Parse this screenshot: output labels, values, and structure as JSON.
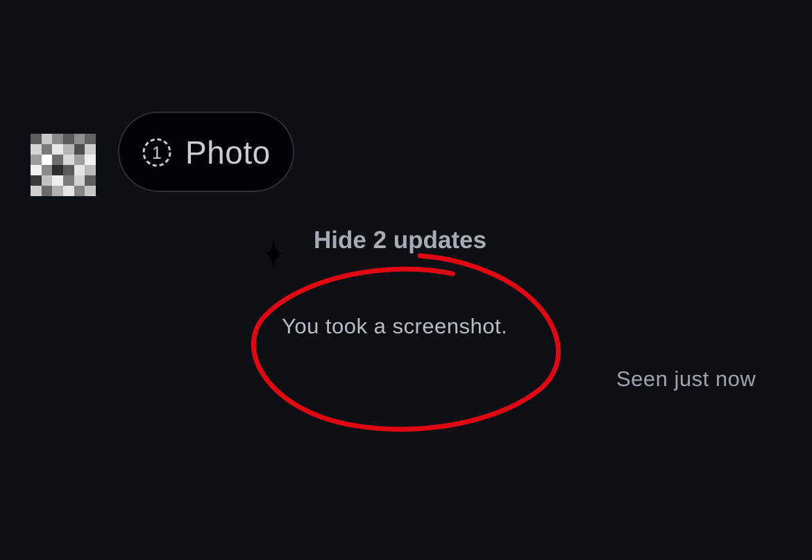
{
  "message": {
    "photo_label": "Photo",
    "view_once_count": "1"
  },
  "updates": {
    "toggle_label": "Hide 2 updates"
  },
  "notice": {
    "text": "You took a screenshot."
  },
  "status": {
    "seen": "Seen just now"
  },
  "icons": {
    "view_once": "view-once-icon",
    "sparkle": "sparkle-icon"
  },
  "colors": {
    "background": "#0c0f14",
    "pill_background": "#010203",
    "annotation": "#e10712"
  }
}
